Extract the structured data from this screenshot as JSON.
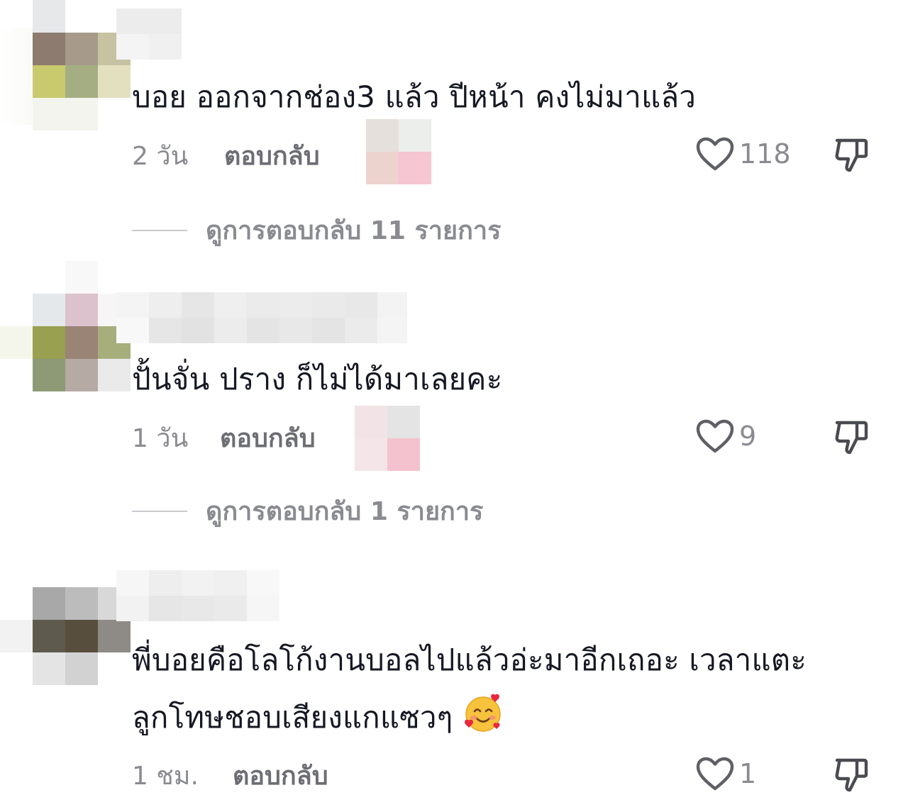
{
  "comments": [
    {
      "text": "บอย ออกจากช่อง3 แล้ว ปีหน้า คงไม่มาแล้ว",
      "time": "2 วัน",
      "reply_label": "ตอบกลับ",
      "likes": "118",
      "view_replies": "ดูการตอบกลับ 11 รายการ"
    },
    {
      "text": "ปั้นจั่น ปราง ก็ไม่ได้มาเลยคะ",
      "time": "1 วัน",
      "reply_label": "ตอบกลับ",
      "likes": "9",
      "view_replies": "ดูการตอบกลับ 1 รายการ"
    },
    {
      "text_line1": "พี่บอยคือโลโก้งานบอลไปแล้วอ่ะมาอีกเถอะ เวลาแตะ",
      "text_line2": "ลูกโทษชอบเสียงแกแซวๆ",
      "emoji": "smiling-face-with-hearts",
      "time": "1 ชม.",
      "reply_label": "ตอบกลับ",
      "likes": "1"
    }
  ],
  "icons": {
    "like": "heart-outline-icon",
    "dislike": "thumbs-down-outline-icon"
  },
  "colors": {
    "text": "#161823",
    "muted": "#8a8b91",
    "reply": "#6d6e74",
    "divider": "#c9cacd"
  }
}
